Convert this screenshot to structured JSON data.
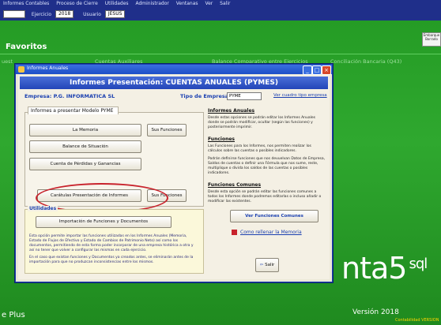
{
  "menu": [
    "Informes Contables",
    "Proceso de Cierre",
    "Utilidades",
    "Administrador",
    "Ventanas",
    "Ver",
    "Salir"
  ],
  "controls": {
    "ejercicio_label": "Ejercicio",
    "ejercicio_value": "2018",
    "usuario_label": "Usuario",
    "usuario_value": "JESUS"
  },
  "desktop": {
    "favoritos": "Favoritos",
    "strip": [
      "uest",
      "Cuentas Auxiliares",
      "Balance Comparativo entre Ejercicios",
      "Conciliación Bancaria (Q43)"
    ],
    "right_button": "Embarque Borrado",
    "brand": "nta5",
    "brand_sup": "sql",
    "version": "Versión 2018",
    "version_sub": "Contabilidad VERSION",
    "eplus": "e Plus"
  },
  "window": {
    "title": "Informes Anuales",
    "header": "Informes Presentación: CUENTAS ANUALES (PYMES)",
    "empresa_label": "Empresa:",
    "empresa_value": "P.G. INFORMATICA SL",
    "tipo_label": "Tipo de Empresa:",
    "tipo_value": "PYME",
    "tipo_link": "Ver cuadro tipo empresa",
    "tab": "Informes a presentar Modelo PYME",
    "buttons": {
      "memoria": "La Memoria",
      "sus_funciones": "Sus Funciones",
      "balance": "Balance de Situación",
      "perdidas": "Cuenta de Pérdidas y Ganancias",
      "caratulas": "Carátulas Presentación de Informes",
      "sus_funciones2": "Sus Funciones",
      "importacion": "Importación de Funciones y Documentos",
      "ver_funciones": "Ver Funciones Comunes",
      "salir": "Salir"
    },
    "utilidades": "Utilidades",
    "util_text": "Esta opción permite importar las funciones utilizadas en los Informes Anuales (Memoria, Estado de Flujos de Efectivo y Estado de Cambios de Patrimonio Neto) así como los documentos, permitiendo de esta forma poder incorporar de una empresa histórica a otra y así no tener que volver a configurar las mismas en cada ejercicio.",
    "util_text2": "En el caso que existan funciones y Documentos ya creados antes, se eliminarán antes de la importación para que no produzcan inconsistencias entre los mismos.",
    "sec_anuales": "Informes Anuales",
    "sec_anuales_desc": "Desde estas opciones se podrán editar los Informes Anuales donde se podrán modificar, ocultar (según las funciones) y posteriormente imprimir.",
    "sec_funciones": "Funciones",
    "sec_funciones_desc": "Las Funciones para los Informes, nos permiten realizar los cálculos sobre las cuentas o posibles indicadores.",
    "sec_funciones_desc2": "Podrán definirse funciones que nos devuelvan Datos de Empresa, Saldos de cuentas o definir una Fórmula que nos sume, reste, multiplique o divida los saldos de las cuentas o posibles indicadores.",
    "sec_comunes": "Funciones Comunes",
    "sec_comunes_desc": "Desde esta opción se podrán editar las funciones comunes a todos los Informes donde podremos editarlas o incluso añadir o modificar las existentes.",
    "rellenar_link": "Como rellenar la Memoria"
  }
}
